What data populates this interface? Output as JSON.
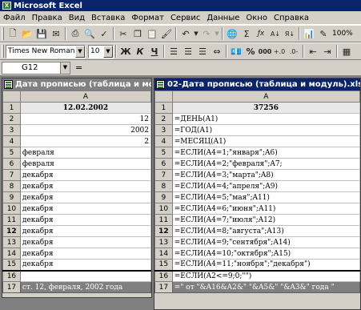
{
  "app": {
    "title": "Microsoft Excel",
    "icon": "excel-icon"
  },
  "menu": [
    "Файл",
    "Правка",
    "Вид",
    "Вставка",
    "Формат",
    "Сервис",
    "Данные",
    "Окно",
    "Справка"
  ],
  "toolbar": {
    "zoom": "100%",
    "font_name": "Times New Roman",
    "font_size": "10",
    "bold": "Ж",
    "italic": "К",
    "underline": "Ч",
    "percent": "%",
    "thousands": "000",
    "sigma": "Σ",
    "fx": "ƒx"
  },
  "formula_bar": {
    "name_box": "G12",
    "eq": "="
  },
  "left_window": {
    "title": "Дата прописью (таблица и мо",
    "col_header": "A",
    "rows": [
      {
        "n": "1",
        "v": "12.02.2002",
        "align": "center"
      },
      {
        "n": "2",
        "v": "12",
        "align": "right"
      },
      {
        "n": "3",
        "v": "2002",
        "align": "right"
      },
      {
        "n": "4",
        "v": "2",
        "align": "right"
      },
      {
        "n": "5",
        "v": "февраля",
        "align": "left"
      },
      {
        "n": "6",
        "v": "февраля",
        "align": "left"
      },
      {
        "n": "7",
        "v": "декабря",
        "align": "left"
      },
      {
        "n": "8",
        "v": "декабря",
        "align": "left"
      },
      {
        "n": "9",
        "v": "декабря",
        "align": "left"
      },
      {
        "n": "10",
        "v": "декабря",
        "align": "left"
      },
      {
        "n": "11",
        "v": "декабря",
        "align": "left"
      },
      {
        "n": "12",
        "v": "декабря",
        "align": "left"
      },
      {
        "n": "13",
        "v": "декабря",
        "align": "left"
      },
      {
        "n": "14",
        "v": "декабря",
        "align": "left"
      },
      {
        "n": "15",
        "v": "декабря",
        "align": "left"
      },
      {
        "n": "16",
        "v": "",
        "align": "left"
      },
      {
        "n": "17",
        "v": "ст. 12, февраля, 2002 года",
        "align": "left"
      }
    ]
  },
  "right_window": {
    "title": "02-Дата прописью (таблица и модуль).xls",
    "col_header": "A",
    "rows": [
      {
        "n": "1",
        "v": "37256",
        "align": "center"
      },
      {
        "n": "2",
        "v": "=ДЕНЬ(A1)",
        "align": "left"
      },
      {
        "n": "3",
        "v": "=ГОД(A1)",
        "align": "left"
      },
      {
        "n": "4",
        "v": "=МЕСЯЦ(A1)",
        "align": "left"
      },
      {
        "n": "5",
        "v": "=ЕСЛИ(A4=1;\"января\";A6)",
        "align": "left"
      },
      {
        "n": "6",
        "v": "=ЕСЛИ(A4=2;\"февраля\";A7;",
        "align": "left"
      },
      {
        "n": "7",
        "v": "=ЕСЛИ(A4=3;\"марта\";A8)",
        "align": "left"
      },
      {
        "n": "8",
        "v": "=ЕСЛИ(A4=4;\"апреля\";A9)",
        "align": "left"
      },
      {
        "n": "9",
        "v": "=ЕСЛИ(A4=5;\"мая\";A11)",
        "align": "left"
      },
      {
        "n": "10",
        "v": "=ЕСЛИ(A4=6;\"июня\";A11)",
        "align": "left"
      },
      {
        "n": "11",
        "v": "=ЕСЛИ(A4=7;\"июля\";A12)",
        "align": "left"
      },
      {
        "n": "12",
        "v": "=ЕСЛИ(A4=8;\"августа\";A13)",
        "align": "left"
      },
      {
        "n": "13",
        "v": "=ЕСЛИ(A4=9;\"сентября\";A14)",
        "align": "left"
      },
      {
        "n": "14",
        "v": "=ЕСЛИ(A4=10;\"октября\";A15)",
        "align": "left"
      },
      {
        "n": "15",
        "v": "=ЕСЛИ(A4=11;\"ноября\";\"декабря\")",
        "align": "left"
      },
      {
        "n": "16",
        "v": "=ЕСЛИ(A2<=9;0;\"\")",
        "align": "left"
      },
      {
        "n": "17",
        "v": "=\" от \"&A16&A2&\" \"&A5&\" \"&A3&\" года \"",
        "align": "left"
      }
    ]
  }
}
